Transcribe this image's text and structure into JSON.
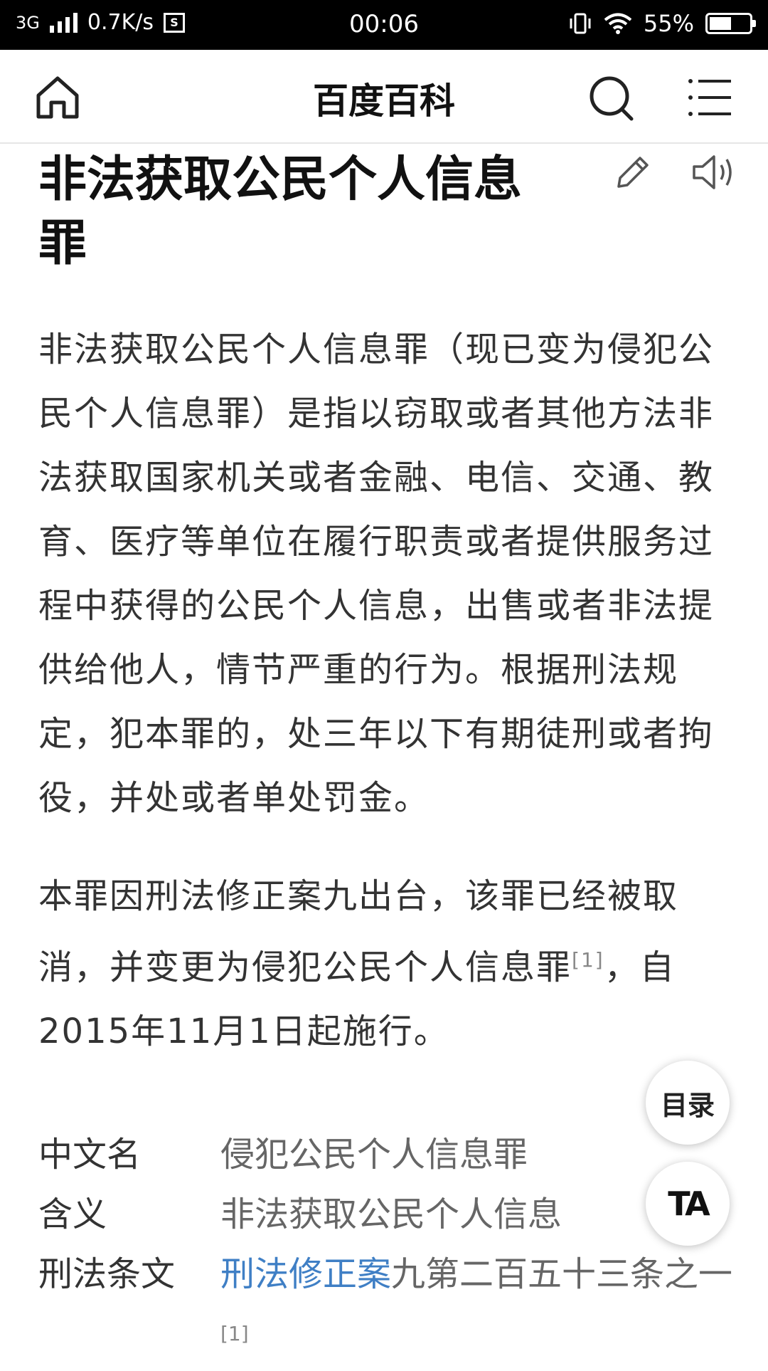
{
  "status_bar": {
    "network": "3G",
    "speed": "0.7K/s",
    "time": "00:06",
    "battery_percent": "55%",
    "battery_level": 0.55
  },
  "navbar": {
    "title": "百度百科"
  },
  "article": {
    "title": "非法获取公民个人信息罪",
    "paragraph1": "非法获取公民个人信息罪（现已变为侵犯公民个人信息罪）是指以窃取或者其他方法非法获取国家机关或者金融、电信、交通、教育、医疗等单位在履行职责或者提供服务过程中获得的公民个人信息，出售或者非法提供给他人，情节严重的行为。根据刑法规定，犯本罪的，处三年以下有期徒刑或者拘役，并处或者单处罚金。",
    "paragraph2_before": "本罪因刑法修正案九出台，该罪已经被取消，并变更为侵犯公民个人信息罪",
    "paragraph2_cite": "[1]",
    "paragraph2_after": "，自2015年11月1日起施行。"
  },
  "infobox": {
    "rows": [
      {
        "key": "中文名",
        "value": "侵犯公民个人信息罪"
      },
      {
        "key": "含义",
        "value": "非法获取公民个人信息"
      },
      {
        "key": "刑法条文",
        "value_link": "刑法修正案",
        "value_rest": "九第二百五十三条之一",
        "cite": "[1]"
      }
    ]
  },
  "floating": {
    "toc_label": "目录",
    "ta_label": "TA"
  }
}
